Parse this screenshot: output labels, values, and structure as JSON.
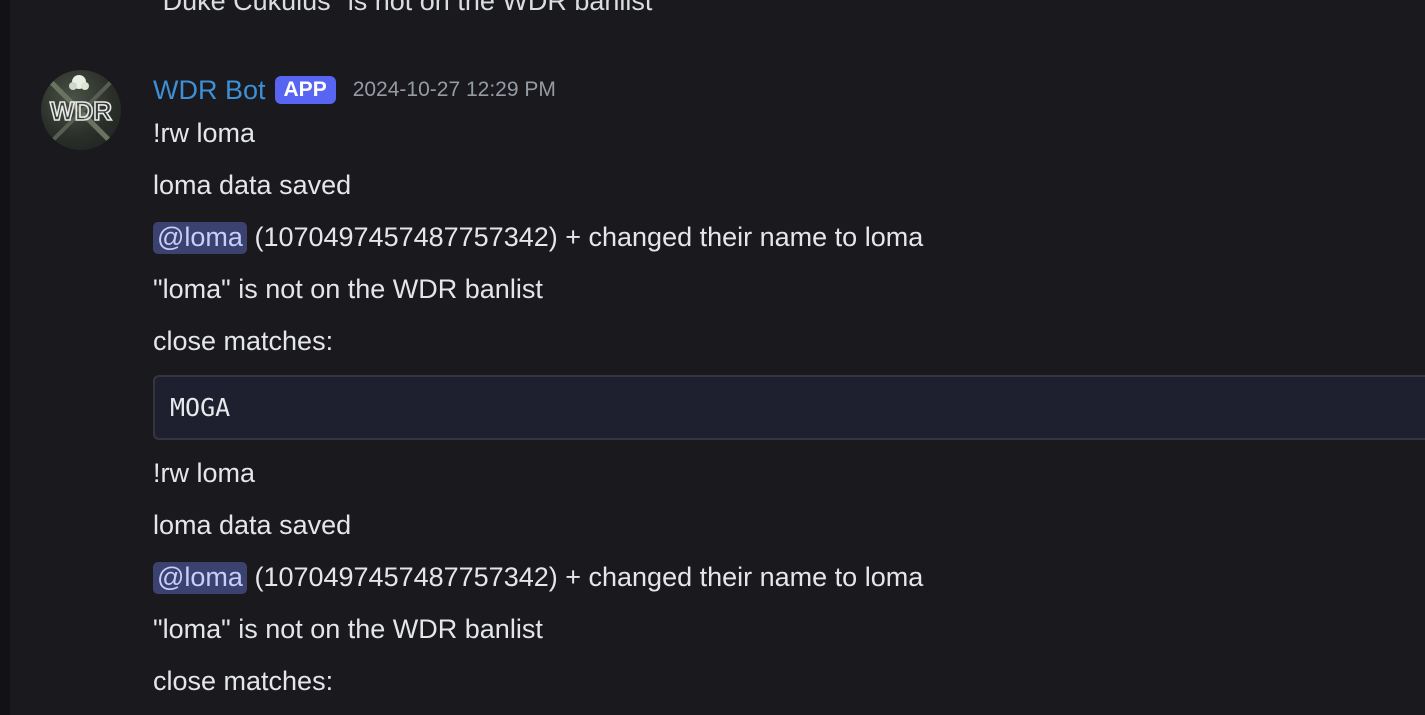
{
  "previous_message": {
    "text": "\"Duke Cukulus\" is not on the WDR banlist"
  },
  "message": {
    "author": "WDR Bot",
    "badge": "APP",
    "timestamp": "2024-10-27 12:29 PM",
    "avatar_text": "WDR",
    "lines": [
      "!rw loma",
      "loma data saved",
      "(1070497457487757342) + changed their name to loma",
      "\"loma\" is not on the WDR banlist",
      "close matches:",
      "!rw loma",
      "loma data saved",
      "(1070497457487757342) + changed their name to loma",
      "\"loma\" is not on the WDR banlist",
      "close matches:"
    ],
    "mention": "@loma",
    "code_block": "MOGA"
  },
  "colors": {
    "background": "#1a1a1e",
    "username": "#3d8fd6",
    "badge": "#5865f2",
    "mention_bg": "#3c4270",
    "mention_text": "#c9cdfb",
    "timestamp": "#949ba4"
  }
}
